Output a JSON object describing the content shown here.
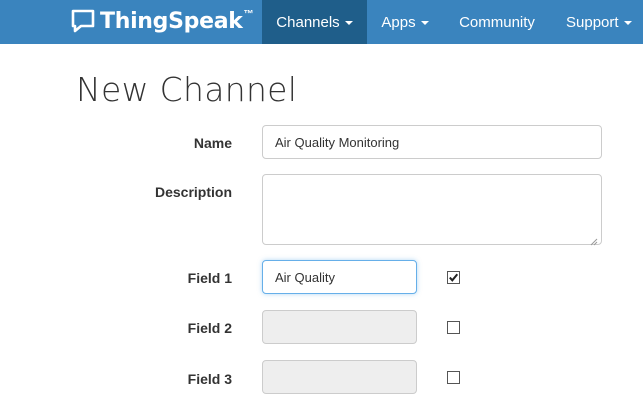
{
  "header": {
    "brand": {
      "name": "ThingSpeak",
      "trademark": "™",
      "icon": "chat-bubble-check-icon"
    },
    "nav": [
      {
        "label": "Channels",
        "dropdown": true,
        "active": true
      },
      {
        "label": "Apps",
        "dropdown": true,
        "active": false
      },
      {
        "label": "Community",
        "dropdown": false,
        "active": false
      },
      {
        "label": "Support",
        "dropdown": true,
        "active": false
      }
    ],
    "colors": {
      "navbar": "#3a84be",
      "active_item": "#1f5e8a"
    }
  },
  "page": {
    "title": "New Channel"
  },
  "form": {
    "name": {
      "label": "Name",
      "value": "Air Quality Monitoring"
    },
    "description": {
      "label": "Description",
      "value": ""
    },
    "fields": [
      {
        "label": "Field 1",
        "value": "Air Quality",
        "checked": true,
        "enabled": true
      },
      {
        "label": "Field 2",
        "value": "",
        "checked": false,
        "enabled": false
      },
      {
        "label": "Field 3",
        "value": "",
        "checked": false,
        "enabled": false
      }
    ]
  }
}
